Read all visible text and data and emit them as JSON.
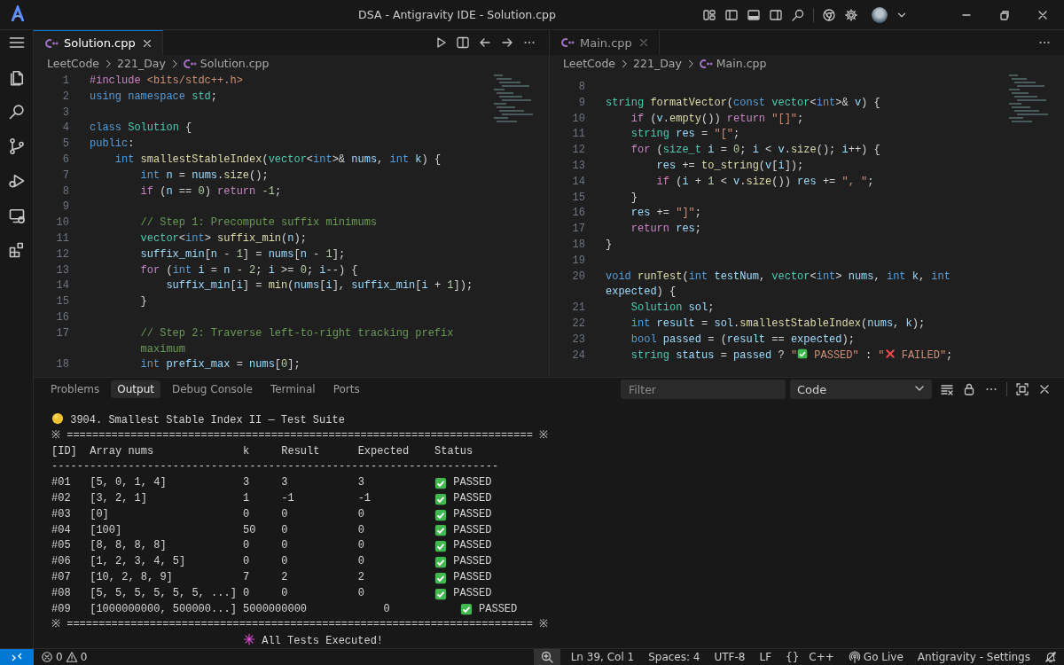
{
  "window": {
    "title": "DSA - Antigravity IDE - Solution.cpp"
  },
  "editors": [
    {
      "tab": {
        "label": "Solution.cpp",
        "selected": true
      },
      "breadcrumbs": [
        "LeetCode",
        "221_Day",
        "Solution.cpp"
      ],
      "lines": [
        {
          "number": "1",
          "segments": [
            {
              "text": "#include ",
              "kind": "d"
            },
            {
              "text": "<bits/stdc++.h>",
              "kind": "s"
            }
          ]
        },
        {
          "number": "2",
          "segments": [
            {
              "text": "using namespace ",
              "kind": "k"
            },
            {
              "text": "std",
              "kind": "t"
            },
            {
              "text": ";",
              "kind": "p"
            }
          ]
        },
        {
          "number": "3"
        },
        {
          "number": "4",
          "segments": [
            {
              "text": "class ",
              "kind": "k"
            },
            {
              "text": "Solution",
              "kind": "t"
            },
            {
              "text": " {",
              "kind": "p"
            }
          ]
        },
        {
          "number": "5",
          "segments": [
            {
              "text": "public",
              "kind": "k"
            },
            {
              "text": ":",
              "kind": "p"
            }
          ]
        },
        {
          "number": "6",
          "segments": [
            {
              "text": "    int ",
              "kind": "k"
            },
            {
              "text": "smallestStableIndex",
              "kind": "f"
            },
            {
              "text": "(",
              "kind": "p"
            },
            {
              "text": "vector",
              "kind": "t"
            },
            {
              "text": "<",
              "kind": "p"
            },
            {
              "text": "int",
              "kind": "k"
            },
            {
              "text": ">& ",
              "kind": "p"
            },
            {
              "text": "nums",
              "kind": "v"
            },
            {
              "text": ", ",
              "kind": "p"
            },
            {
              "text": "int ",
              "kind": "k"
            },
            {
              "text": "k",
              "kind": "v"
            },
            {
              "text": ") {",
              "kind": "p"
            }
          ]
        },
        {
          "number": "7",
          "segments": [
            {
              "text": "        int ",
              "kind": "k"
            },
            {
              "text": "n",
              "kind": "v"
            },
            {
              "text": " = ",
              "kind": "p"
            },
            {
              "text": "nums",
              "kind": "v"
            },
            {
              "text": ".",
              "kind": "p"
            },
            {
              "text": "size",
              "kind": "f"
            },
            {
              "text": "();",
              "kind": "p"
            }
          ]
        },
        {
          "number": "8",
          "segments": [
            {
              "text": "        if ",
              "kind": "c"
            },
            {
              "text": "(",
              "kind": "p"
            },
            {
              "text": "n",
              "kind": "v"
            },
            {
              "text": " == ",
              "kind": "p"
            },
            {
              "text": "0",
              "kind": "n"
            },
            {
              "text": ") ",
              "kind": "p"
            },
            {
              "text": "return ",
              "kind": "c"
            },
            {
              "text": "-1",
              "kind": "n"
            },
            {
              "text": ";",
              "kind": "p"
            }
          ]
        },
        {
          "number": "9"
        },
        {
          "number": "10",
          "segments": [
            {
              "text": "        // Step 1: Precompute suffix minimums",
              "kind": "m"
            }
          ]
        },
        {
          "number": "11",
          "segments": [
            {
              "text": "        vector",
              "kind": "t"
            },
            {
              "text": "<",
              "kind": "p"
            },
            {
              "text": "int",
              "kind": "k"
            },
            {
              "text": "> ",
              "kind": "p"
            },
            {
              "text": "suffix_min",
              "kind": "f"
            },
            {
              "text": "(",
              "kind": "p"
            },
            {
              "text": "n",
              "kind": "v"
            },
            {
              "text": ");",
              "kind": "p"
            }
          ]
        },
        {
          "number": "12",
          "segments": [
            {
              "text": "        suffix_min",
              "kind": "v"
            },
            {
              "text": "[",
              "kind": "p"
            },
            {
              "text": "n",
              "kind": "v"
            },
            {
              "text": " - ",
              "kind": "p"
            },
            {
              "text": "1",
              "kind": "n"
            },
            {
              "text": "] = ",
              "kind": "p"
            },
            {
              "text": "nums",
              "kind": "v"
            },
            {
              "text": "[",
              "kind": "p"
            },
            {
              "text": "n",
              "kind": "v"
            },
            {
              "text": " - ",
              "kind": "p"
            },
            {
              "text": "1",
              "kind": "n"
            },
            {
              "text": "];",
              "kind": "p"
            }
          ]
        },
        {
          "number": "13",
          "segments": [
            {
              "text": "        for ",
              "kind": "c"
            },
            {
              "text": "(",
              "kind": "p"
            },
            {
              "text": "int ",
              "kind": "k"
            },
            {
              "text": "i",
              "kind": "v"
            },
            {
              "text": " = ",
              "kind": "p"
            },
            {
              "text": "n",
              "kind": "v"
            },
            {
              "text": " - ",
              "kind": "p"
            },
            {
              "text": "2",
              "kind": "n"
            },
            {
              "text": "; ",
              "kind": "p"
            },
            {
              "text": "i",
              "kind": "v"
            },
            {
              "text": " >= ",
              "kind": "p"
            },
            {
              "text": "0",
              "kind": "n"
            },
            {
              "text": "; ",
              "kind": "p"
            },
            {
              "text": "i",
              "kind": "v"
            },
            {
              "text": "--) {",
              "kind": "p"
            }
          ]
        },
        {
          "number": "14",
          "segments": [
            {
              "text": "            suffix_min",
              "kind": "v"
            },
            {
              "text": "[",
              "kind": "p"
            },
            {
              "text": "i",
              "kind": "v"
            },
            {
              "text": "] = ",
              "kind": "p"
            },
            {
              "text": "min",
              "kind": "f"
            },
            {
              "text": "(",
              "kind": "p"
            },
            {
              "text": "nums",
              "kind": "v"
            },
            {
              "text": "[",
              "kind": "p"
            },
            {
              "text": "i",
              "kind": "v"
            },
            {
              "text": "], ",
              "kind": "p"
            },
            {
              "text": "suffix_min",
              "kind": "v"
            },
            {
              "text": "[",
              "kind": "p"
            },
            {
              "text": "i",
              "kind": "v"
            },
            {
              "text": " + ",
              "kind": "p"
            },
            {
              "text": "1",
              "kind": "n"
            },
            {
              "text": "]);",
              "kind": "p"
            }
          ]
        },
        {
          "number": "15",
          "segments": [
            {
              "text": "        }",
              "kind": "p"
            }
          ]
        },
        {
          "number": "16"
        },
        {
          "number": "17",
          "segments": [
            {
              "text": "        // Step 2: Traverse left-to-right tracking prefix maximum",
              "kind": "m"
            }
          ]
        },
        {
          "number": "18",
          "segments": [
            {
              "text": "        int ",
              "kind": "k"
            },
            {
              "text": "prefix_max",
              "kind": "v"
            },
            {
              "text": " = ",
              "kind": "p"
            },
            {
              "text": "nums",
              "kind": "v"
            },
            {
              "text": "[",
              "kind": "p"
            },
            {
              "text": "0",
              "kind": "n"
            },
            {
              "text": "];",
              "kind": "p"
            }
          ]
        }
      ]
    },
    {
      "tab": {
        "label": "Main.cpp",
        "selected": false
      },
      "breadcrumbs": [
        "LeetCode",
        "221_Day",
        "Main.cpp"
      ],
      "lines": [
        {
          "number": "8"
        },
        {
          "number": "9",
          "segments": [
            {
              "text": "string ",
              "kind": "t"
            },
            {
              "text": "formatVector",
              "kind": "f"
            },
            {
              "text": "(",
              "kind": "p"
            },
            {
              "text": "const ",
              "kind": "k"
            },
            {
              "text": "vector",
              "kind": "t"
            },
            {
              "text": "<",
              "kind": "p"
            },
            {
              "text": "int",
              "kind": "k"
            },
            {
              "text": ">& ",
              "kind": "p"
            },
            {
              "text": "v",
              "kind": "v"
            },
            {
              "text": ") {",
              "kind": "p"
            }
          ]
        },
        {
          "number": "10",
          "segments": [
            {
              "text": "    if ",
              "kind": "c"
            },
            {
              "text": "(",
              "kind": "p"
            },
            {
              "text": "v",
              "kind": "v"
            },
            {
              "text": ".",
              "kind": "p"
            },
            {
              "text": "empty",
              "kind": "f"
            },
            {
              "text": "()) ",
              "kind": "p"
            },
            {
              "text": "return ",
              "kind": "c"
            },
            {
              "text": "\"[]\"",
              "kind": "s"
            },
            {
              "text": ";",
              "kind": "p"
            }
          ]
        },
        {
          "number": "11",
          "segments": [
            {
              "text": "    string ",
              "kind": "t"
            },
            {
              "text": "res",
              "kind": "v"
            },
            {
              "text": " = ",
              "kind": "p"
            },
            {
              "text": "\"[\"",
              "kind": "s"
            },
            {
              "text": ";",
              "kind": "p"
            }
          ]
        },
        {
          "number": "12",
          "segments": [
            {
              "text": "    for ",
              "kind": "c"
            },
            {
              "text": "(",
              "kind": "p"
            },
            {
              "text": "size_t ",
              "kind": "t"
            },
            {
              "text": "i",
              "kind": "v"
            },
            {
              "text": " = ",
              "kind": "p"
            },
            {
              "text": "0",
              "kind": "n"
            },
            {
              "text": "; ",
              "kind": "p"
            },
            {
              "text": "i",
              "kind": "v"
            },
            {
              "text": " < ",
              "kind": "p"
            },
            {
              "text": "v",
              "kind": "v"
            },
            {
              "text": ".",
              "kind": "p"
            },
            {
              "text": "size",
              "kind": "f"
            },
            {
              "text": "(); ",
              "kind": "p"
            },
            {
              "text": "i",
              "kind": "v"
            },
            {
              "text": "++) {",
              "kind": "p"
            }
          ]
        },
        {
          "number": "13",
          "segments": [
            {
              "text": "        res",
              "kind": "v"
            },
            {
              "text": " += ",
              "kind": "p"
            },
            {
              "text": "to_string",
              "kind": "f"
            },
            {
              "text": "(",
              "kind": "p"
            },
            {
              "text": "v",
              "kind": "v"
            },
            {
              "text": "[",
              "kind": "p"
            },
            {
              "text": "i",
              "kind": "v"
            },
            {
              "text": "]);",
              "kind": "p"
            }
          ]
        },
        {
          "number": "14",
          "segments": [
            {
              "text": "        if ",
              "kind": "c"
            },
            {
              "text": "(",
              "kind": "p"
            },
            {
              "text": "i",
              "kind": "v"
            },
            {
              "text": " + ",
              "kind": "p"
            },
            {
              "text": "1",
              "kind": "n"
            },
            {
              "text": " < ",
              "kind": "p"
            },
            {
              "text": "v",
              "kind": "v"
            },
            {
              "text": ".",
              "kind": "p"
            },
            {
              "text": "size",
              "kind": "f"
            },
            {
              "text": "()) ",
              "kind": "p"
            },
            {
              "text": "res",
              "kind": "v"
            },
            {
              "text": " += ",
              "kind": "p"
            },
            {
              "text": "\", \"",
              "kind": "s"
            },
            {
              "text": ";",
              "kind": "p"
            }
          ]
        },
        {
          "number": "15",
          "segments": [
            {
              "text": "    }",
              "kind": "p"
            }
          ]
        },
        {
          "number": "16",
          "segments": [
            {
              "text": "    res",
              "kind": "v"
            },
            {
              "text": " += ",
              "kind": "p"
            },
            {
              "text": "\"]\"",
              "kind": "s"
            },
            {
              "text": ";",
              "kind": "p"
            }
          ]
        },
        {
          "number": "17",
          "segments": [
            {
              "text": "    return ",
              "kind": "c"
            },
            {
              "text": "res",
              "kind": "v"
            },
            {
              "text": ";",
              "kind": "p"
            }
          ]
        },
        {
          "number": "18",
          "segments": [
            {
              "text": "}",
              "kind": "p"
            }
          ]
        },
        {
          "number": "19"
        },
        {
          "number": "20",
          "segments": [
            {
              "text": "void ",
              "kind": "k"
            },
            {
              "text": "runTest",
              "kind": "f"
            },
            {
              "text": "(",
              "kind": "p"
            },
            {
              "text": "int ",
              "kind": "k"
            },
            {
              "text": "testNum",
              "kind": "v"
            },
            {
              "text": ", ",
              "kind": "p"
            },
            {
              "text": "vector",
              "kind": "t"
            },
            {
              "text": "<",
              "kind": "p"
            },
            {
              "text": "int",
              "kind": "k"
            },
            {
              "text": "> ",
              "kind": "p"
            },
            {
              "text": "nums",
              "kind": "v"
            },
            {
              "text": ", ",
              "kind": "p"
            },
            {
              "text": "int ",
              "kind": "k"
            },
            {
              "text": "k",
              "kind": "v"
            },
            {
              "text": ", ",
              "kind": "p"
            },
            {
              "text": "int ",
              "kind": "k"
            },
            {
              "text": "expected",
              "kind": "v"
            },
            {
              "text": ") {",
              "kind": "p"
            }
          ]
        },
        {
          "number": "21",
          "segments": [
            {
              "text": "    Solution ",
              "kind": "t"
            },
            {
              "text": "sol",
              "kind": "v"
            },
            {
              "text": ";",
              "kind": "p"
            }
          ]
        },
        {
          "number": "22",
          "segments": [
            {
              "text": "    int ",
              "kind": "k"
            },
            {
              "text": "result",
              "kind": "v"
            },
            {
              "text": " = ",
              "kind": "p"
            },
            {
              "text": "sol",
              "kind": "v"
            },
            {
              "text": ".",
              "kind": "p"
            },
            {
              "text": "smallestStableIndex",
              "kind": "f"
            },
            {
              "text": "(",
              "kind": "p"
            },
            {
              "text": "nums",
              "kind": "v"
            },
            {
              "text": ", ",
              "kind": "p"
            },
            {
              "text": "k",
              "kind": "v"
            },
            {
              "text": ");",
              "kind": "p"
            }
          ]
        },
        {
          "number": "23",
          "segments": [
            {
              "text": "    bool ",
              "kind": "k"
            },
            {
              "text": "passed",
              "kind": "v"
            },
            {
              "text": " = (",
              "kind": "p"
            },
            {
              "text": "result",
              "kind": "v"
            },
            {
              "text": " == ",
              "kind": "p"
            },
            {
              "text": "expected",
              "kind": "v"
            },
            {
              "text": ");",
              "kind": "p"
            }
          ]
        },
        {
          "number": "24",
          "segments": [
            {
              "text": "    string ",
              "kind": "t"
            },
            {
              "text": "status",
              "kind": "v"
            },
            {
              "text": " = ",
              "kind": "p"
            },
            {
              "text": "passed",
              "kind": "v"
            },
            {
              "text": " ? ",
              "kind": "p"
            },
            {
              "text": "\"",
              "kind": "s"
            },
            {
              "kind": "check"
            },
            {
              "text": " PASSED\"",
              "kind": "s"
            },
            {
              "text": " : ",
              "kind": "p"
            },
            {
              "text": "\"",
              "kind": "s"
            },
            {
              "kind": "cross"
            },
            {
              "text": " FAILED\"",
              "kind": "s"
            },
            {
              "text": ";",
              "kind": "p"
            }
          ]
        }
      ]
    }
  ],
  "panel": {
    "tabs": [
      {
        "label": "Problems",
        "selected": false
      },
      {
        "label": "Output",
        "selected": true
      },
      {
        "label": "Debug Console",
        "selected": false
      },
      {
        "label": "Terminal",
        "selected": false
      },
      {
        "label": "Ports",
        "selected": false
      }
    ],
    "filter": {
      "placeholder": "Filter"
    },
    "channel": {
      "value": "Code"
    },
    "output": {
      "title": "3904. Smallest Stable Index II — Test Suite",
      "rule": "※ ========================================================================= ※",
      "header": [
        "[ID]",
        "Array nums",
        "k",
        "Result",
        "Expected",
        "Status"
      ],
      "divider": "----------------------------------------------------------------------",
      "rows": [
        {
          "id": "#01",
          "array": "[5, 0, 1, 4]",
          "k": "3",
          "result": "3",
          "expected": "3",
          "status": "PASSED",
          "passed": true
        },
        {
          "id": "#02",
          "array": "[3, 2, 1]",
          "k": "1",
          "result": "-1",
          "expected": "-1",
          "status": "PASSED",
          "passed": true
        },
        {
          "id": "#03",
          "array": "[0]",
          "k": "0",
          "result": "0",
          "expected": "0",
          "status": "PASSED",
          "passed": true
        },
        {
          "id": "#04",
          "array": "[100]",
          "k": "50",
          "result": "0",
          "expected": "0",
          "status": "PASSED",
          "passed": true
        },
        {
          "id": "#05",
          "array": "[8, 8, 8, 8]",
          "k": "0",
          "result": "0",
          "expected": "0",
          "status": "PASSED",
          "passed": true
        },
        {
          "id": "#06",
          "array": "[1, 2, 3, 4, 5]",
          "k": "0",
          "result": "0",
          "expected": "0",
          "status": "PASSED",
          "passed": true
        },
        {
          "id": "#07",
          "array": "[10, 2, 8, 9]",
          "k": "7",
          "result": "2",
          "expected": "2",
          "status": "PASSED",
          "passed": true
        },
        {
          "id": "#08",
          "array": "[5, 5, 5, 5, 5, 5, ...]",
          "k": "0",
          "result": "0",
          "expected": "0",
          "status": "PASSED",
          "passed": true
        },
        {
          "id": "#09",
          "array": "[1000000000, 500000...]",
          "k": "5000000000",
          "expected": "0",
          "status": "PASSED",
          "passed": true
        }
      ],
      "rule_bottom": "※ ========================================================================= ※",
      "footer": "All Tests Executed!"
    }
  },
  "status_bar": {
    "errors": "0",
    "warnings": "0",
    "position": "Ln 39, Col 1",
    "indentation": "Spaces: 4",
    "encoding": "UTF-8",
    "eol": "LF",
    "braces": "{}",
    "language": "C++",
    "live_server": "Go Live",
    "settings": "Antigravity - Settings"
  }
}
